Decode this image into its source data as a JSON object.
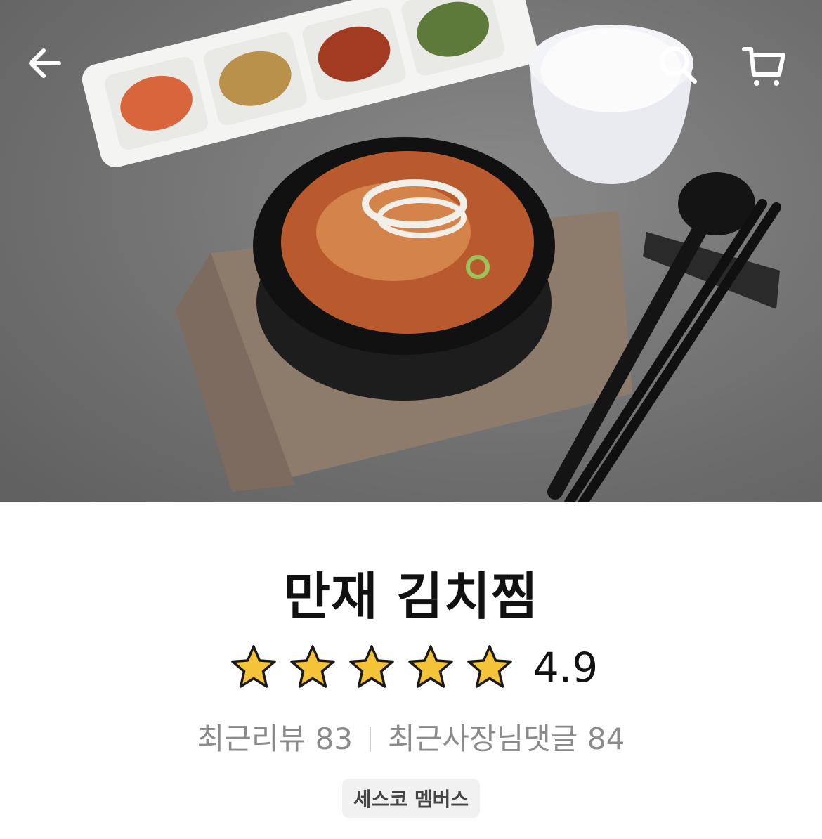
{
  "header": {
    "back_icon": "arrow-left-icon",
    "search_icon": "search-icon",
    "cart_icon": "cart-icon"
  },
  "product": {
    "title": "만재 김치찜",
    "rating": 1.0,
    "rating_text": "4.9",
    "review_label": "최근리뷰 83",
    "owner_reply_label": "최근사장님댓글 84",
    "badge": "세스코 멤버스"
  },
  "colors": {
    "star_fill": "#f5c338",
    "star_stroke": "#1a1a1a"
  }
}
